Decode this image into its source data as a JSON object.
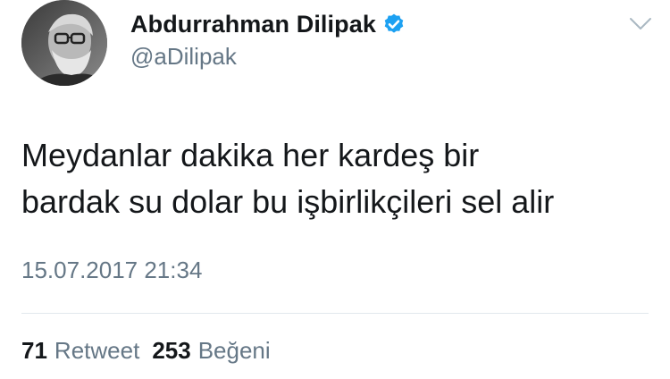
{
  "user": {
    "display_name": "Abdurrahman Dilipak",
    "handle": "@aDilipak",
    "verified": true
  },
  "tweet": {
    "text": "Meydanlar dakika her kardeş bir\nbardak su dolar bu işbirlikçileri sel alir",
    "timestamp": "15.07.2017 21:34"
  },
  "stats": {
    "retweet_count": "71",
    "retweet_label": "Retweet",
    "like_count": "253",
    "like_label": "Beğeni"
  },
  "icons": {
    "verified": "verified-badge-icon",
    "menu": "chevron-down-icon"
  },
  "colors": {
    "text": "#14171a",
    "secondary": "#657786",
    "verified_blue": "#1da1f2",
    "divider": "#e1e8ed"
  }
}
